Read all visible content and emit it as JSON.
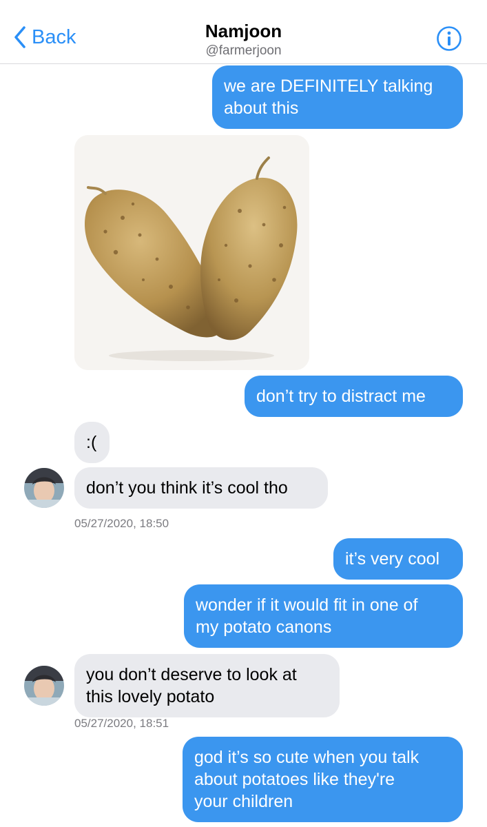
{
  "header": {
    "back_label": "Back",
    "title": "Namjoon",
    "handle": "@farmerjoon",
    "info_icon": "info-circle-icon",
    "accent": "#2a8ff7"
  },
  "colors": {
    "outgoing_bubble": "#3b96ef",
    "incoming_bubble": "#e9eaee",
    "timestamp": "#7b7b80"
  },
  "messages": [
    {
      "from": "me",
      "text": "we are DEFINITELY talking\nabout this"
    },
    {
      "from": "me",
      "type": "image",
      "description": "heart-shaped potato photo"
    },
    {
      "from": "me",
      "text": "don’t try to distract me"
    },
    {
      "from": "them",
      "text": ":("
    },
    {
      "from": "them",
      "text": "don’t you think it’s cool tho"
    },
    {
      "type": "timestamp",
      "text": "05/27/2020, 18:50"
    },
    {
      "from": "me",
      "text": "it’s very cool"
    },
    {
      "from": "me",
      "text": "wonder if it would fit in one of\nmy potato canons"
    },
    {
      "from": "them",
      "text": "you don’t deserve to look at\nthis lovely potato"
    },
    {
      "type": "timestamp",
      "text": "05/27/2020, 18:51"
    },
    {
      "from": "me",
      "text": "god it’s so cute when you talk\nabout potatoes like they're\nyour children"
    }
  ]
}
